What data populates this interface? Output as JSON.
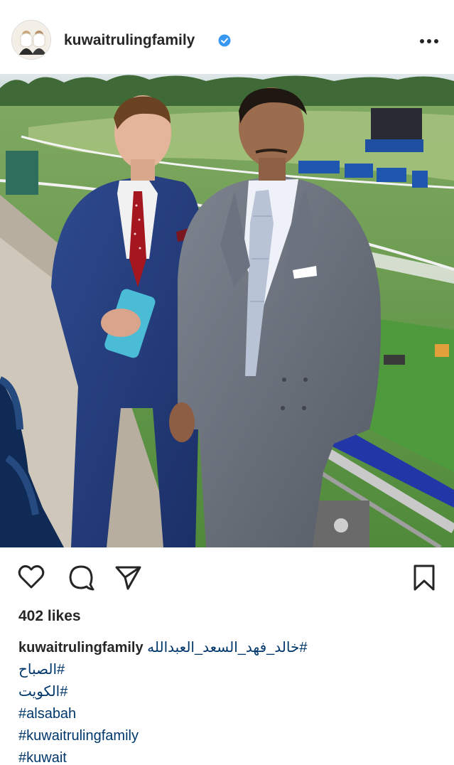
{
  "post": {
    "username": "kuwaitrulingfamily",
    "verified": true,
    "likes_text": "402 likes",
    "caption": {
      "username": "kuwaitrulingfamily",
      "first_tag": "#خالد_فهد_السعد_العبدالله",
      "tags": [
        "#الصباح",
        "#الكويت",
        "#alsabah",
        "#kuwaitrulingfamily",
        "#kuwait"
      ]
    }
  },
  "icons": {
    "more": "more-options-icon",
    "like": "heart-icon",
    "comment": "comment-bubble-icon",
    "share": "paper-plane-icon",
    "save": "bookmark-icon",
    "verified": "verified-badge-icon"
  },
  "colors": {
    "text": "#262626",
    "hashtag": "#00376b",
    "verified": "#3897f0"
  }
}
